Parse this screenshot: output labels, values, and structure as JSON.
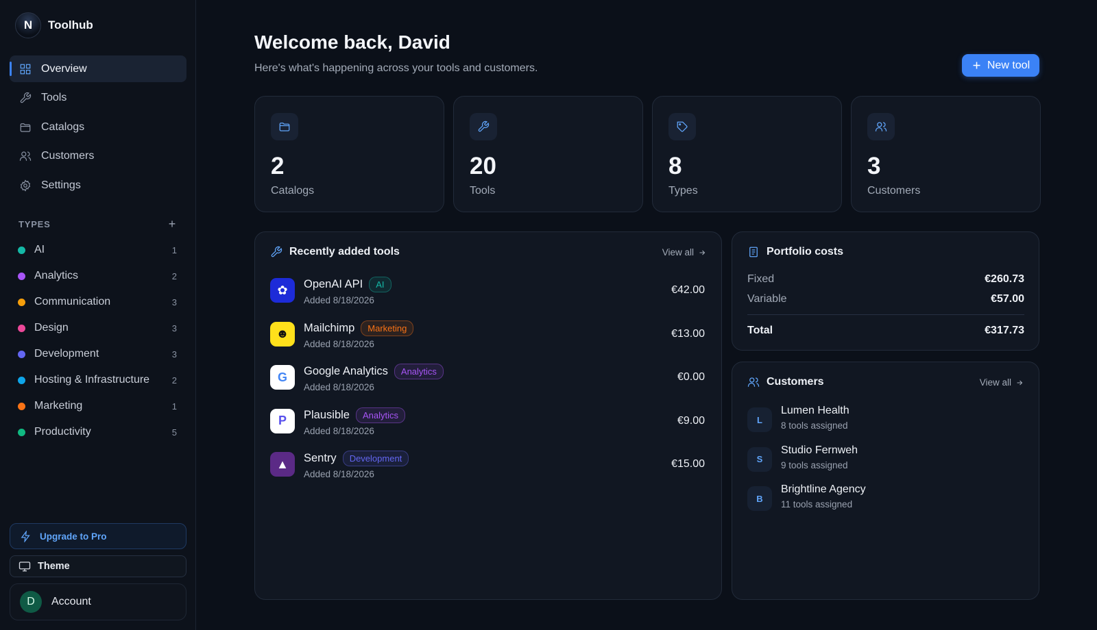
{
  "app": {
    "name": "Toolhub",
    "logo_letter": "N"
  },
  "nav": [
    {
      "label": "Overview",
      "icon": "grid-icon",
      "active": true
    },
    {
      "label": "Tools",
      "icon": "wrench-icon"
    },
    {
      "label": "Catalogs",
      "icon": "folder-icon"
    },
    {
      "label": "Customers",
      "icon": "users-icon"
    },
    {
      "label": "Settings",
      "icon": "gear-icon"
    }
  ],
  "types": {
    "heading": "TYPES",
    "add_label": "+",
    "items": [
      {
        "label": "AI",
        "count": "1",
        "color": "#14b8a6"
      },
      {
        "label": "Analytics",
        "count": "2",
        "color": "#a855f7"
      },
      {
        "label": "Communication",
        "count": "3",
        "color": "#f59e0b"
      },
      {
        "label": "Design",
        "count": "3",
        "color": "#ec4899"
      },
      {
        "label": "Development",
        "count": "3",
        "color": "#6366f1"
      },
      {
        "label": "Hosting & Infrastructure",
        "count": "2",
        "color": "#0ea5e9"
      },
      {
        "label": "Marketing",
        "count": "1",
        "color": "#f97316"
      },
      {
        "label": "Productivity",
        "count": "5",
        "color": "#10b981"
      }
    ]
  },
  "footer": {
    "upgrade_label": "Upgrade to Pro",
    "theme_label": "Theme",
    "account_label": "Account",
    "account_initial": "D"
  },
  "header": {
    "title": "Welcome back, David",
    "subtitle": "Here's what's happening across your tools and customers.",
    "new_tool_label": "New tool"
  },
  "stats": [
    {
      "value": "2",
      "label": "Catalogs",
      "icon": "folder-icon"
    },
    {
      "value": "20",
      "label": "Tools",
      "icon": "wrench-icon"
    },
    {
      "value": "8",
      "label": "Types",
      "icon": "tag-icon"
    },
    {
      "value": "3",
      "label": "Customers",
      "icon": "users-icon"
    }
  ],
  "recent_tools": {
    "title": "Recently added tools",
    "view_all": "View all",
    "items": [
      {
        "name": "OpenAI API",
        "badge": "AI",
        "badge_color": "#14b8a6",
        "added": "Added 8/18/2026",
        "price": "€42.00",
        "logo": "openai-logo"
      },
      {
        "name": "Mailchimp",
        "badge": "Marketing",
        "badge_color": "#f97316",
        "added": "Added 8/18/2026",
        "price": "€13.00",
        "logo": "mailchimp-logo"
      },
      {
        "name": "Google Analytics",
        "badge": "Analytics",
        "badge_color": "#a855f7",
        "added": "Added 8/18/2026",
        "price": "€0.00",
        "logo": "google-logo"
      },
      {
        "name": "Plausible",
        "badge": "Analytics",
        "badge_color": "#a855f7",
        "added": "Added 8/18/2026",
        "price": "€9.00",
        "logo": "plausible-logo"
      },
      {
        "name": "Sentry",
        "badge": "Development",
        "badge_color": "#6366f1",
        "added": "Added 8/18/2026",
        "price": "€15.00",
        "logo": "sentry-logo"
      }
    ]
  },
  "portfolio": {
    "title": "Portfolio costs",
    "fixed_label": "Fixed",
    "fixed_value": "€260.73",
    "variable_label": "Variable",
    "variable_value": "€57.00",
    "total_label": "Total",
    "total_value": "€317.73"
  },
  "customers": {
    "title": "Customers",
    "view_all": "View all",
    "items": [
      {
        "initial": "L",
        "name": "Lumen Health",
        "tools": "8 tools assigned"
      },
      {
        "initial": "S",
        "name": "Studio Fernweh",
        "tools": "9 tools assigned"
      },
      {
        "initial": "B",
        "name": "Brightline Agency",
        "tools": "11 tools assigned"
      }
    ]
  }
}
